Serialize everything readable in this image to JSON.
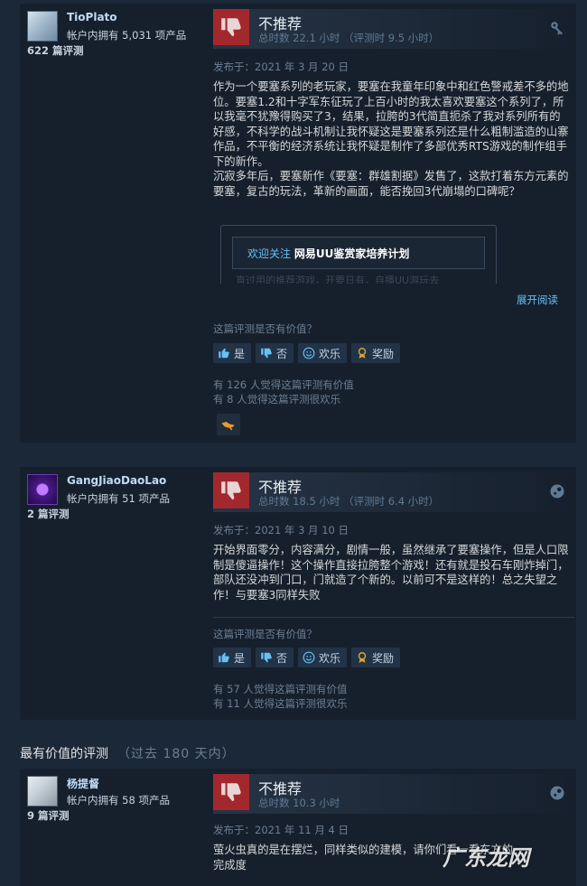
{
  "reviews": [
    {
      "author": "TioPlato",
      "owned": "帐户内拥有 5,031 项产品",
      "review_count": "622 篇评测",
      "rating": "不推荐",
      "hours": "总时数 22.1 小时 （评测时 9.5 小时）",
      "posted": "发布于：2021 年 3 月 20 日",
      "content": [
        "作为一个要塞系列的老玩家，要塞在我童年印象中和红色警戒差不多的地位。要塞1.2和十字军东征玩了上百小时的我太喜欢要塞这个系列了，所以我毫不犹豫得购买了3，结果，拉胯的3代简直扼杀了我对系列所有的好感，不科学的战斗机制让我怀疑这是要塞系列还是什么粗制滥造的山寨作品，不平衡的经济系统让我怀疑是制作了多部优秀RTS游戏的制作组手下的新作。",
        "沉寂多年后，要塞新作《要塞：群雄割据》发售了，这款打着东方元素的要塞，复古的玩法，革新的画面，能否挽回3代崩塌的口碑呢？"
      ],
      "embed_prefix": "欢迎关注",
      "embed_title": "网易UU鉴赏家培养计划",
      "embed_faded": "直过用的推荐游戏，开要日有，自播UU游玩去",
      "expand": "展开阅读",
      "helpful_q": "这篇评测是否有价值？",
      "buttons": [
        "是",
        "否",
        "欢乐",
        "奖励"
      ],
      "stat_helpful": "有 126 人觉得这篇评测有价值",
      "stat_funny": "有 8 人觉得这篇评测很欢乐"
    },
    {
      "author": "GangJiaoDaoLao",
      "owned": "帐户内拥有 51 项产品",
      "review_count": "2 篇评测",
      "rating": "不推荐",
      "hours": "总时数 18.5 小时 （评测时 6.4 小时）",
      "posted": "发布于：2021 年 3 月 10 日",
      "content": [
        "开始界面零分，内容满分，剧情一般，虽然继承了要塞操作，但是人口限制是傻逼操作！这个操作直接拉胯整个游戏！还有就是投石车刚炸掉门，部队还没冲到门口，门就造了个新的。以前可不是这样的！总之失望之作！与要塞3同样失败"
      ],
      "helpful_q": "这篇评测是否有价值？",
      "buttons": [
        "是",
        "否",
        "欢乐",
        "奖励"
      ],
      "stat_helpful": "有 57 人觉得这篇评测有价值",
      "stat_funny": "有 11 人觉得这篇评测很欢乐"
    },
    {
      "author": "杨提督",
      "owned": "帐户内拥有 58 项产品",
      "review_count": "9 篇评测",
      "rating": "不推荐",
      "hours": "总时数 10.3 小时",
      "posted": "发布于：2021 年 11 月 4 日",
      "content": [
        "萤火虫真的是在摆烂，同样类似的建模，请你们看一看东方的",
        "完成度"
      ]
    }
  ],
  "section": {
    "title": "最有价值的评测",
    "subtitle": "（过去 180 天内）"
  },
  "watermark": "广东龙网",
  "colors": {
    "background": "#1b2838",
    "card": "#16202d",
    "thumb_down": "#a3282e",
    "link": "#66c0f4",
    "award": "#d5a72b"
  }
}
